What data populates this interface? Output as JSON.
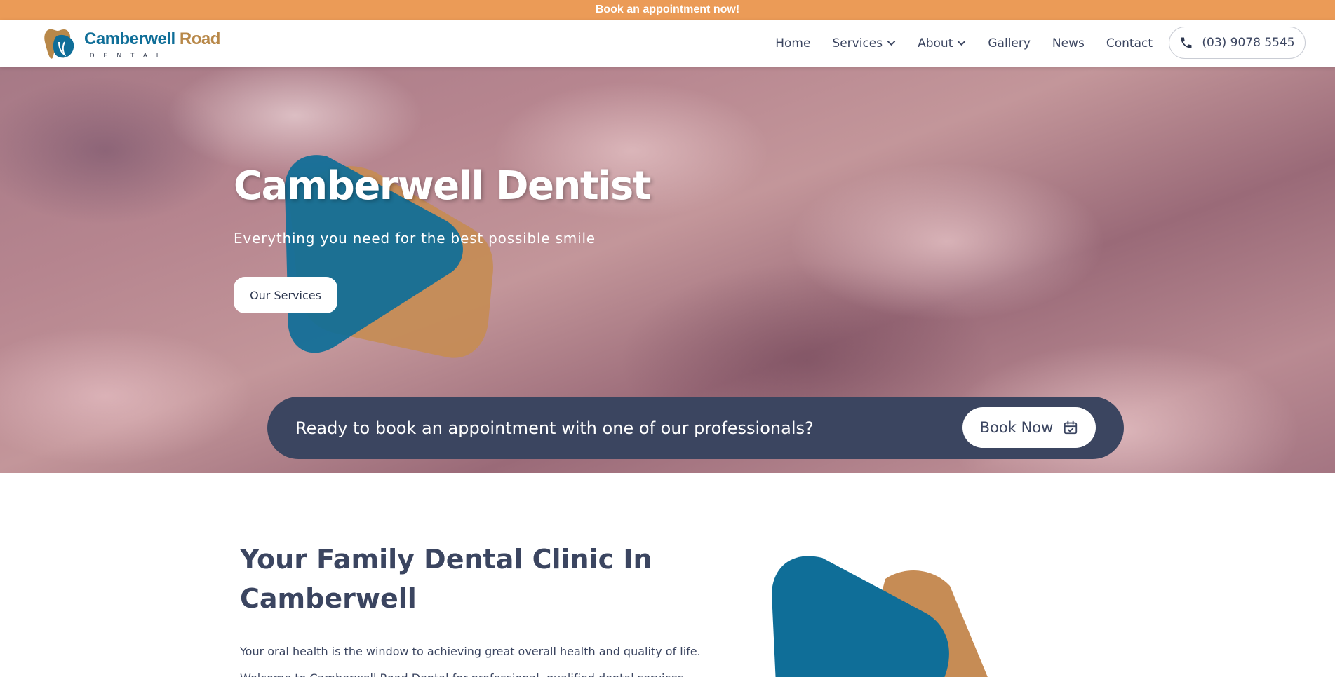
{
  "announcement": {
    "text": "Book an appointment now!"
  },
  "brand": {
    "name_part1": "Camberwell",
    "name_part2": "Road",
    "subtitle": "DENTAL",
    "colors": {
      "blue": "#0f6e98",
      "gold": "#b88849",
      "navy": "#3b4560",
      "orange": "#eb9b57"
    }
  },
  "nav": {
    "items": [
      {
        "label": "Home",
        "has_dropdown": false
      },
      {
        "label": "Services",
        "has_dropdown": true
      },
      {
        "label": "About",
        "has_dropdown": true
      },
      {
        "label": "Gallery",
        "has_dropdown": false
      },
      {
        "label": "News",
        "has_dropdown": false
      },
      {
        "label": "Contact",
        "has_dropdown": false
      }
    ],
    "phone": {
      "label": "(03) 9078 5545",
      "icon": "phone-icon"
    }
  },
  "hero": {
    "title": "Camberwell Dentist",
    "subtitle": "Everything you need for the best possible smile",
    "cta_label": "Our Services"
  },
  "booking": {
    "text": "Ready to book an appointment with one of our professionals?",
    "button_label": "Book Now",
    "button_icon": "calendar-check-icon"
  },
  "content": {
    "title": "Your Family Dental Clinic In Camberwell",
    "paragraph1": "Your oral health is the window to achieving great overall health and quality of life.",
    "paragraph2": "Welcome to Camberwell Road Dental for professional, qualified dental services."
  }
}
